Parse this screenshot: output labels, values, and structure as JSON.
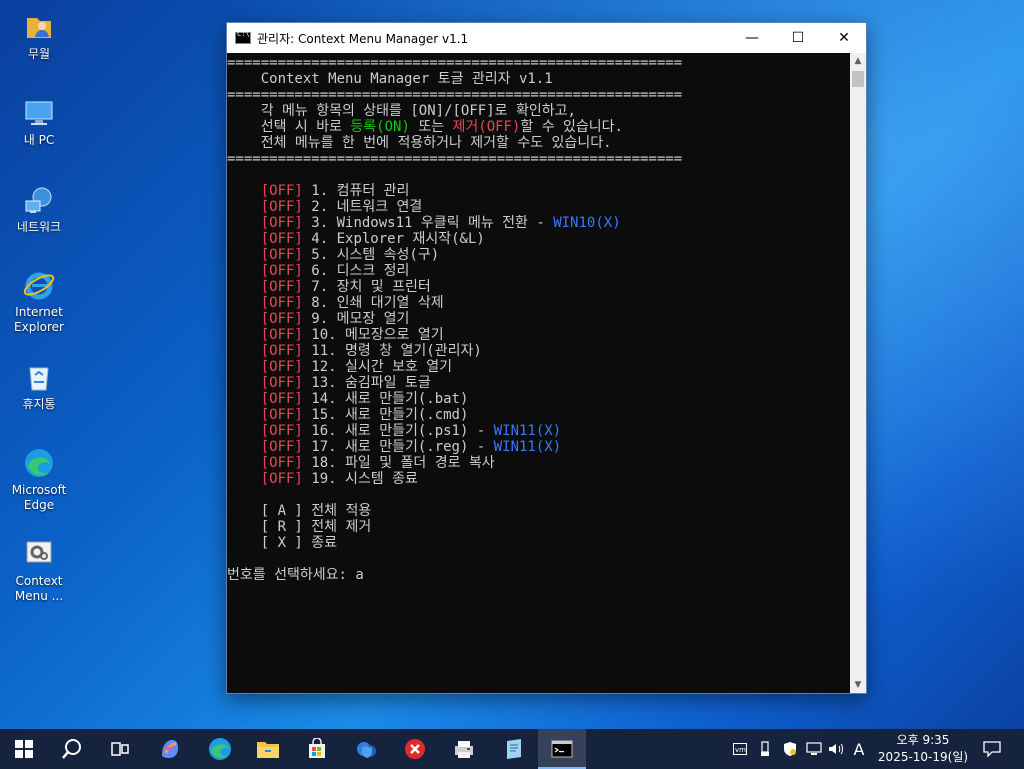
{
  "desktop": {
    "icons": [
      {
        "label": "무월",
        "icon": "user-folder-icon"
      },
      {
        "label": "내 PC",
        "icon": "computer-icon"
      },
      {
        "label": "네트워크",
        "icon": "network-icon"
      },
      {
        "label": "Internet Explorer",
        "icon": "internet-explorer-icon"
      },
      {
        "label": "휴지통",
        "icon": "recycle-bin-icon"
      },
      {
        "label": "Microsoft Edge",
        "icon": "edge-icon"
      },
      {
        "label": "Context Menu ...",
        "icon": "settings-app-icon"
      }
    ]
  },
  "window": {
    "title": "관리자:  Context Menu Manager v1.1",
    "minimize": "—",
    "maximize": "☐",
    "close": "✕"
  },
  "console": {
    "separator": "======================================================",
    "header_title": "    Context Menu Manager 토글 관리자 v1.1",
    "info1": "    각 메뉴 항목의 상태를 [ON]/[OFF]로 확인하고,",
    "info2_a": "    선택 시 바로 ",
    "info2_on": "등록(ON)",
    "info2_b": " 또는 ",
    "info2_off": "제거(OFF)",
    "info2_c": "할 수 있습니다.",
    "info3": "    전체 메뉴를 한 번에 적용하거나 제거할 수도 있습니다.",
    "items": [
      {
        "status": "[OFF]",
        "text": " 1. 컴퓨터 관리",
        "note": ""
      },
      {
        "status": "[OFF]",
        "text": " 2. 네트워크 연결",
        "note": ""
      },
      {
        "status": "[OFF]",
        "text": " 3. Windows11 우클릭 메뉴 전환 - ",
        "note": "WIN10(X)"
      },
      {
        "status": "[OFF]",
        "text": " 4. Explorer 재시작(&L)",
        "note": ""
      },
      {
        "status": "[OFF]",
        "text": " 5. 시스템 속성(구)",
        "note": ""
      },
      {
        "status": "[OFF]",
        "text": " 6. 디스크 정리",
        "note": ""
      },
      {
        "status": "[OFF]",
        "text": " 7. 장치 및 프린터",
        "note": ""
      },
      {
        "status": "[OFF]",
        "text": " 8. 인쇄 대기열 삭제",
        "note": ""
      },
      {
        "status": "[OFF]",
        "text": " 9. 메모장 열기",
        "note": ""
      },
      {
        "status": "[OFF]",
        "text": " 10. 메모장으로 열기",
        "note": ""
      },
      {
        "status": "[OFF]",
        "text": " 11. 명령 창 열기(관리자)",
        "note": ""
      },
      {
        "status": "[OFF]",
        "text": " 12. 실시간 보호 열기",
        "note": ""
      },
      {
        "status": "[OFF]",
        "text": " 13. 숨김파일 토글",
        "note": ""
      },
      {
        "status": "[OFF]",
        "text": " 14. 새로 만들기(.bat)",
        "note": ""
      },
      {
        "status": "[OFF]",
        "text": " 15. 새로 만들기(.cmd)",
        "note": ""
      },
      {
        "status": "[OFF]",
        "text": " 16. 새로 만들기(.ps1) - ",
        "note": "WIN11(X)"
      },
      {
        "status": "[OFF]",
        "text": " 17. 새로 만들기(.reg) - ",
        "note": "WIN11(X)"
      },
      {
        "status": "[OFF]",
        "text": " 18. 파일 및 폴더 경로 복사",
        "note": ""
      },
      {
        "status": "[OFF]",
        "text": " 19. 시스템 종료",
        "note": ""
      }
    ],
    "actions": [
      "    [ A ] 전체 적용",
      "    [ R ] 전체 제거",
      "    [ X ] 종료"
    ],
    "prompt": "번호를 선택하세요: a"
  },
  "taskbar": {
    "apps": [
      "start-icon",
      "search-icon",
      "task-view-icon",
      "copilot-icon",
      "edge-icon",
      "file-explorer-icon",
      "store-icon",
      "defender-icon",
      "close-app-icon",
      "printer-app-icon",
      "notepad-app-icon",
      "terminal-icon"
    ],
    "ime": "A",
    "time": "오후 9:35",
    "date": "2025-10-19(일)"
  }
}
